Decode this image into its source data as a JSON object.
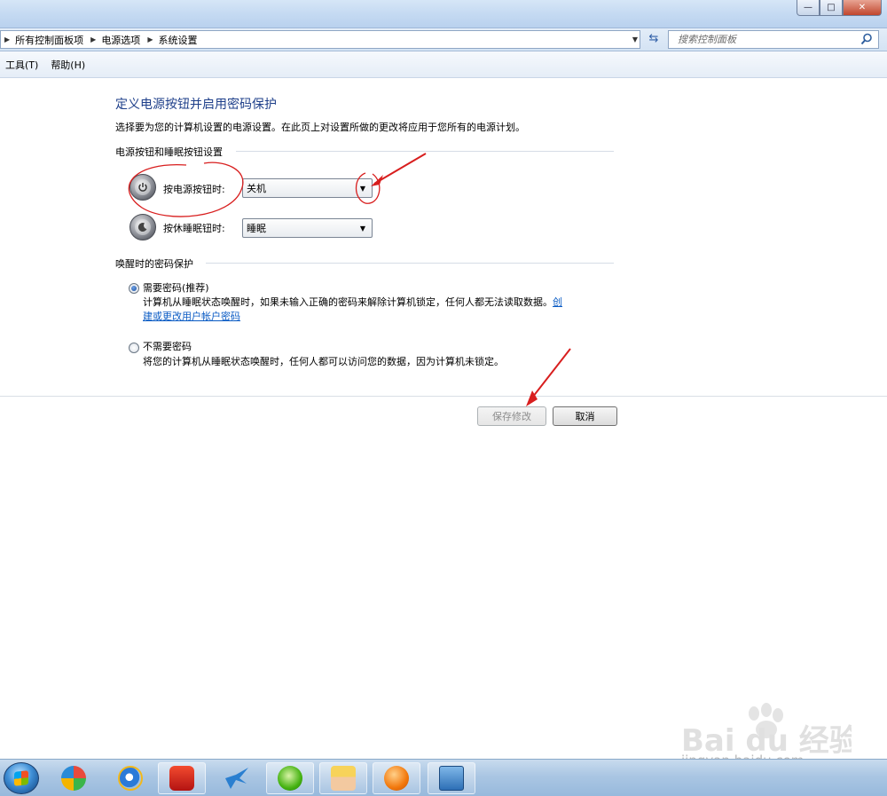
{
  "window": {
    "min_glyph": "—",
    "max_glyph": "□",
    "close_glyph": "✕"
  },
  "address": {
    "crumbs": [
      "所有控制面板项",
      "电源选项",
      "系统设置"
    ],
    "search_placeholder": "搜索控制面板"
  },
  "menu": {
    "items": [
      "工具(T)",
      "帮助(H)"
    ]
  },
  "page": {
    "title": "定义电源按钮并启用密码保护",
    "description": "选择要为您的计算机设置的电源设置。在此页上对设置所做的更改将应用于您所有的电源计划。"
  },
  "power_section": {
    "heading": "电源按钮和睡眠按钮设置",
    "power_button_label": "按电源按钮时:",
    "power_button_value": "关机",
    "sleep_button_label": "按休睡眠钮时:",
    "sleep_button_value": "睡眠"
  },
  "password_section": {
    "heading": "唤醒时的密码保护",
    "require": {
      "label": "需要密码(推荐)",
      "desc_line1": "计算机从睡眠状态唤醒时，如果未输入正确的密码来解除计算机锁定，任何人都无法读取数据。",
      "link_part1": "创",
      "link_part2": "建或更改用户帐户密码",
      "checked": true
    },
    "no_require": {
      "label": "不需要密码",
      "desc": "将您的计算机从睡眠状态唤醒时，任何人都可以访问您的数据，因为计算机未锁定。",
      "checked": false
    }
  },
  "buttons": {
    "save": "保存修改",
    "cancel": "取消"
  },
  "watermark": {
    "brand": "Bai du 经验",
    "url": "jingyan.baidu.com"
  },
  "colors": {
    "title_blue": "#1e3f8a",
    "link_blue": "#0a5bc4",
    "annotation_red": "#d81e1e"
  }
}
